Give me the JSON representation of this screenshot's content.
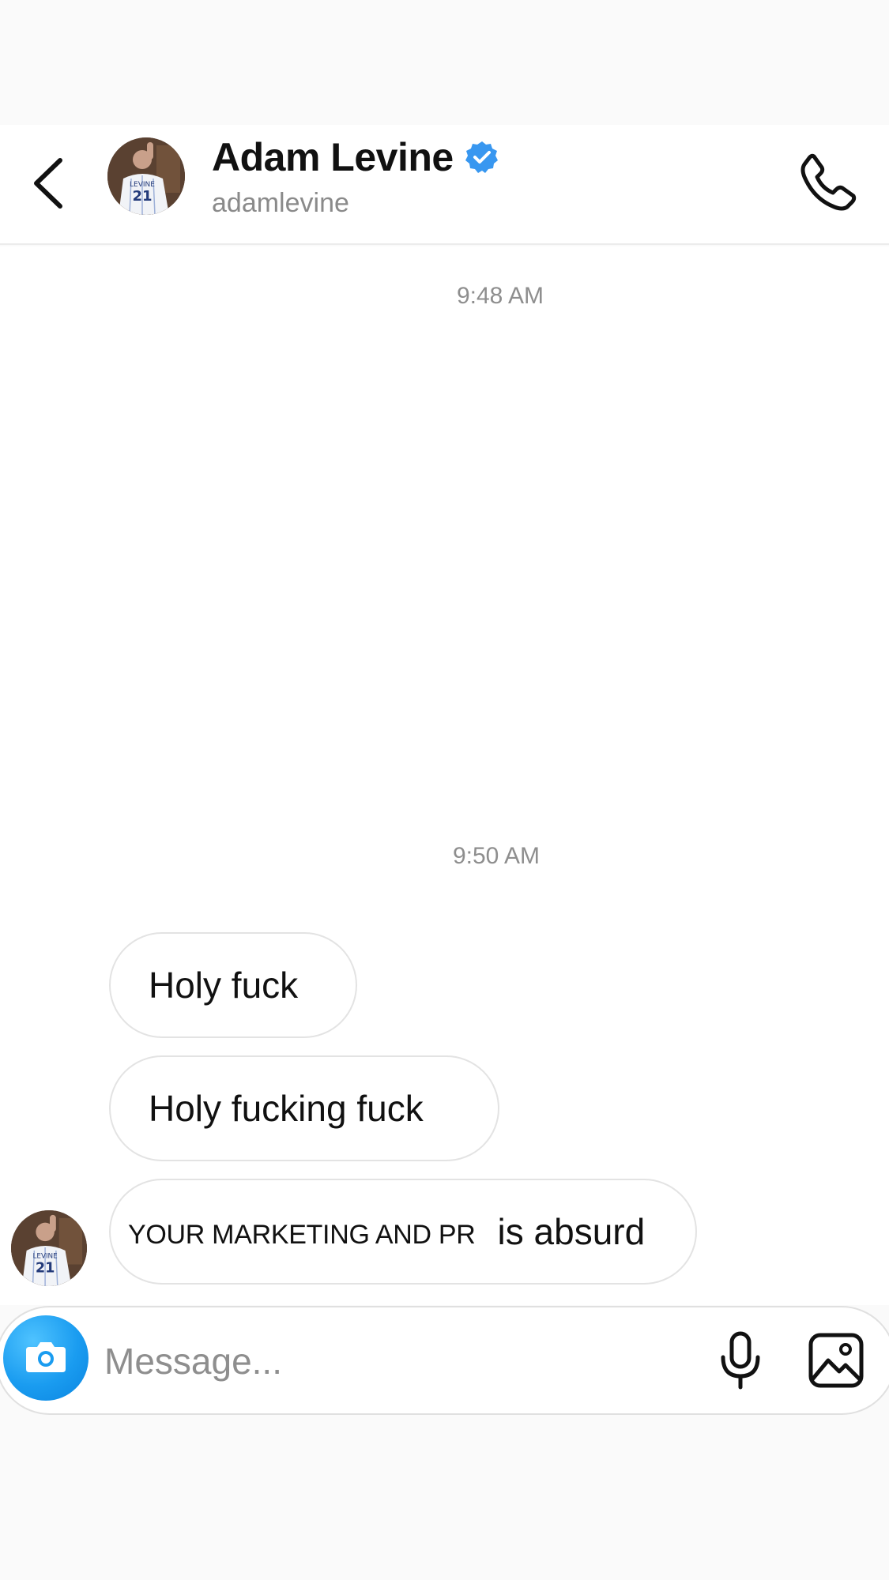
{
  "header": {
    "name": "Adam Levine",
    "username": "adamlevine",
    "verified": true,
    "back_icon": "chevron-left-icon",
    "call_icon": "phone-icon",
    "verified_icon": "verified-badge-icon",
    "verified_color": "#3897f0"
  },
  "chat": {
    "timestamps": [
      "9:48 AM",
      "9:50 AM"
    ],
    "messages": [
      {
        "text": "Holy fuck"
      },
      {
        "text": "Holy fucking fuck"
      },
      {
        "overlay_text": "YOUR MARKETING AND PR",
        "text": "is absurd"
      }
    ]
  },
  "composer": {
    "placeholder": "Message...",
    "camera_icon": "camera-icon",
    "mic_icon": "microphone-icon",
    "gallery_icon": "gallery-icon",
    "accent_color": "#1a9cf0"
  }
}
